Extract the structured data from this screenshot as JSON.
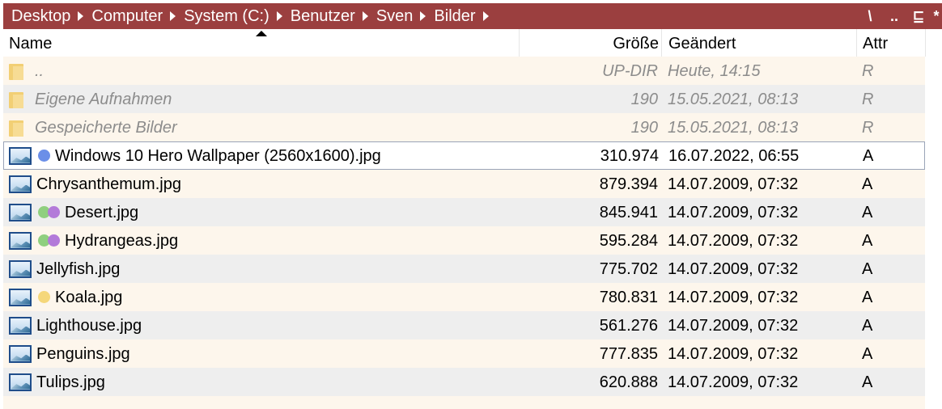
{
  "breadcrumb": [
    "Desktop",
    "Computer",
    "System (C:)",
    "Benutzer",
    "Sven",
    "Bilder"
  ],
  "toolbar": {
    "a": "\\",
    "b": "..",
    "c": "⊑",
    "d": "*"
  },
  "columns": {
    "name": "Name",
    "size": "Größe",
    "date": "Geändert",
    "attr": "Attr"
  },
  "colors": {
    "accent": "#9b3f3f",
    "list_bg": "#fdf6ec",
    "tag_blue": "#6b8fe8",
    "tag_green": "#8fcf7f",
    "tag_purple": "#b37ad9",
    "tag_yellow": "#f5d77a"
  },
  "rows": [
    {
      "type": "folder",
      "name": "..",
      "size": "UP-DIR",
      "date": "Heute, 14:15",
      "attr": "R"
    },
    {
      "type": "folder",
      "name": "Eigene Aufnahmen",
      "size": "190",
      "date": "15.05.2021, 08:13",
      "attr": "R"
    },
    {
      "type": "folder",
      "name": "Gespeicherte Bilder",
      "size": "190",
      "date": "15.05.2021, 08:13",
      "attr": "R"
    },
    {
      "type": "image",
      "name": "Windows 10 Hero Wallpaper (2560x1600).jpg",
      "size": "310.974",
      "date": "16.07.2022, 06:55",
      "attr": "A",
      "tags": [
        "blue"
      ],
      "selected": true
    },
    {
      "type": "image",
      "name": "Chrysanthemum.jpg",
      "size": "879.394",
      "date": "14.07.2009, 07:32",
      "attr": "A",
      "tags": []
    },
    {
      "type": "image",
      "name": "Desert.jpg",
      "size": "845.941",
      "date": "14.07.2009, 07:32",
      "attr": "A",
      "tags": [
        "green",
        "purple"
      ]
    },
    {
      "type": "image",
      "name": "Hydrangeas.jpg",
      "size": "595.284",
      "date": "14.07.2009, 07:32",
      "attr": "A",
      "tags": [
        "green",
        "purple"
      ]
    },
    {
      "type": "image",
      "name": "Jellyfish.jpg",
      "size": "775.702",
      "date": "14.07.2009, 07:32",
      "attr": "A",
      "tags": []
    },
    {
      "type": "image",
      "name": "Koala.jpg",
      "size": "780.831",
      "date": "14.07.2009, 07:32",
      "attr": "A",
      "tags": [
        "yellow"
      ]
    },
    {
      "type": "image",
      "name": "Lighthouse.jpg",
      "size": "561.276",
      "date": "14.07.2009, 07:32",
      "attr": "A",
      "tags": []
    },
    {
      "type": "image",
      "name": "Penguins.jpg",
      "size": "777.835",
      "date": "14.07.2009, 07:32",
      "attr": "A",
      "tags": []
    },
    {
      "type": "image",
      "name": "Tulips.jpg",
      "size": "620.888",
      "date": "14.07.2009, 07:32",
      "attr": "A",
      "tags": []
    }
  ]
}
